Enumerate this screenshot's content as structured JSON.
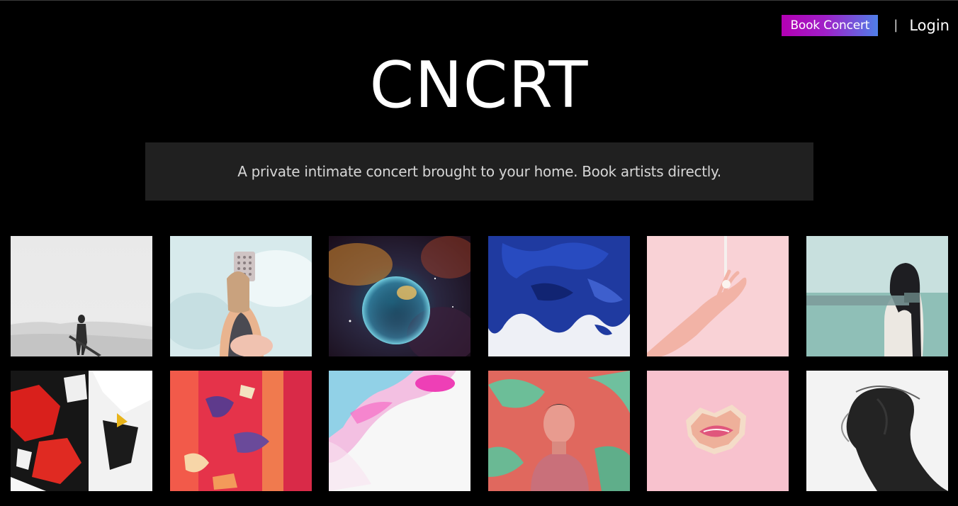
{
  "header": {
    "book_label": "Book Concert",
    "separator": "|",
    "login_label": "Login",
    "accent_gradient": [
      "#b300b3",
      "#4f7fe8"
    ]
  },
  "hero": {
    "title": "CNCRT",
    "tagline": "A private intimate concert brought to your home. Book artists directly."
  },
  "gallery": {
    "tiles": [
      {
        "name": "guitarist-desert-photo"
      },
      {
        "name": "person-holding-disc-photo"
      },
      {
        "name": "nebula-bubble-photo"
      },
      {
        "name": "blue-ink-in-water-photo"
      },
      {
        "name": "hand-with-paint-pink-photo"
      },
      {
        "name": "blindfolded-woman-sea-photo"
      },
      {
        "name": "red-black-abstract-collage-photo"
      },
      {
        "name": "red-painted-wood-photo"
      },
      {
        "name": "pink-blue-fluid-art-photo"
      },
      {
        "name": "man-neon-portrait-photo"
      },
      {
        "name": "torn-paper-lips-photo"
      },
      {
        "name": "veiled-face-bw-photo"
      }
    ]
  }
}
